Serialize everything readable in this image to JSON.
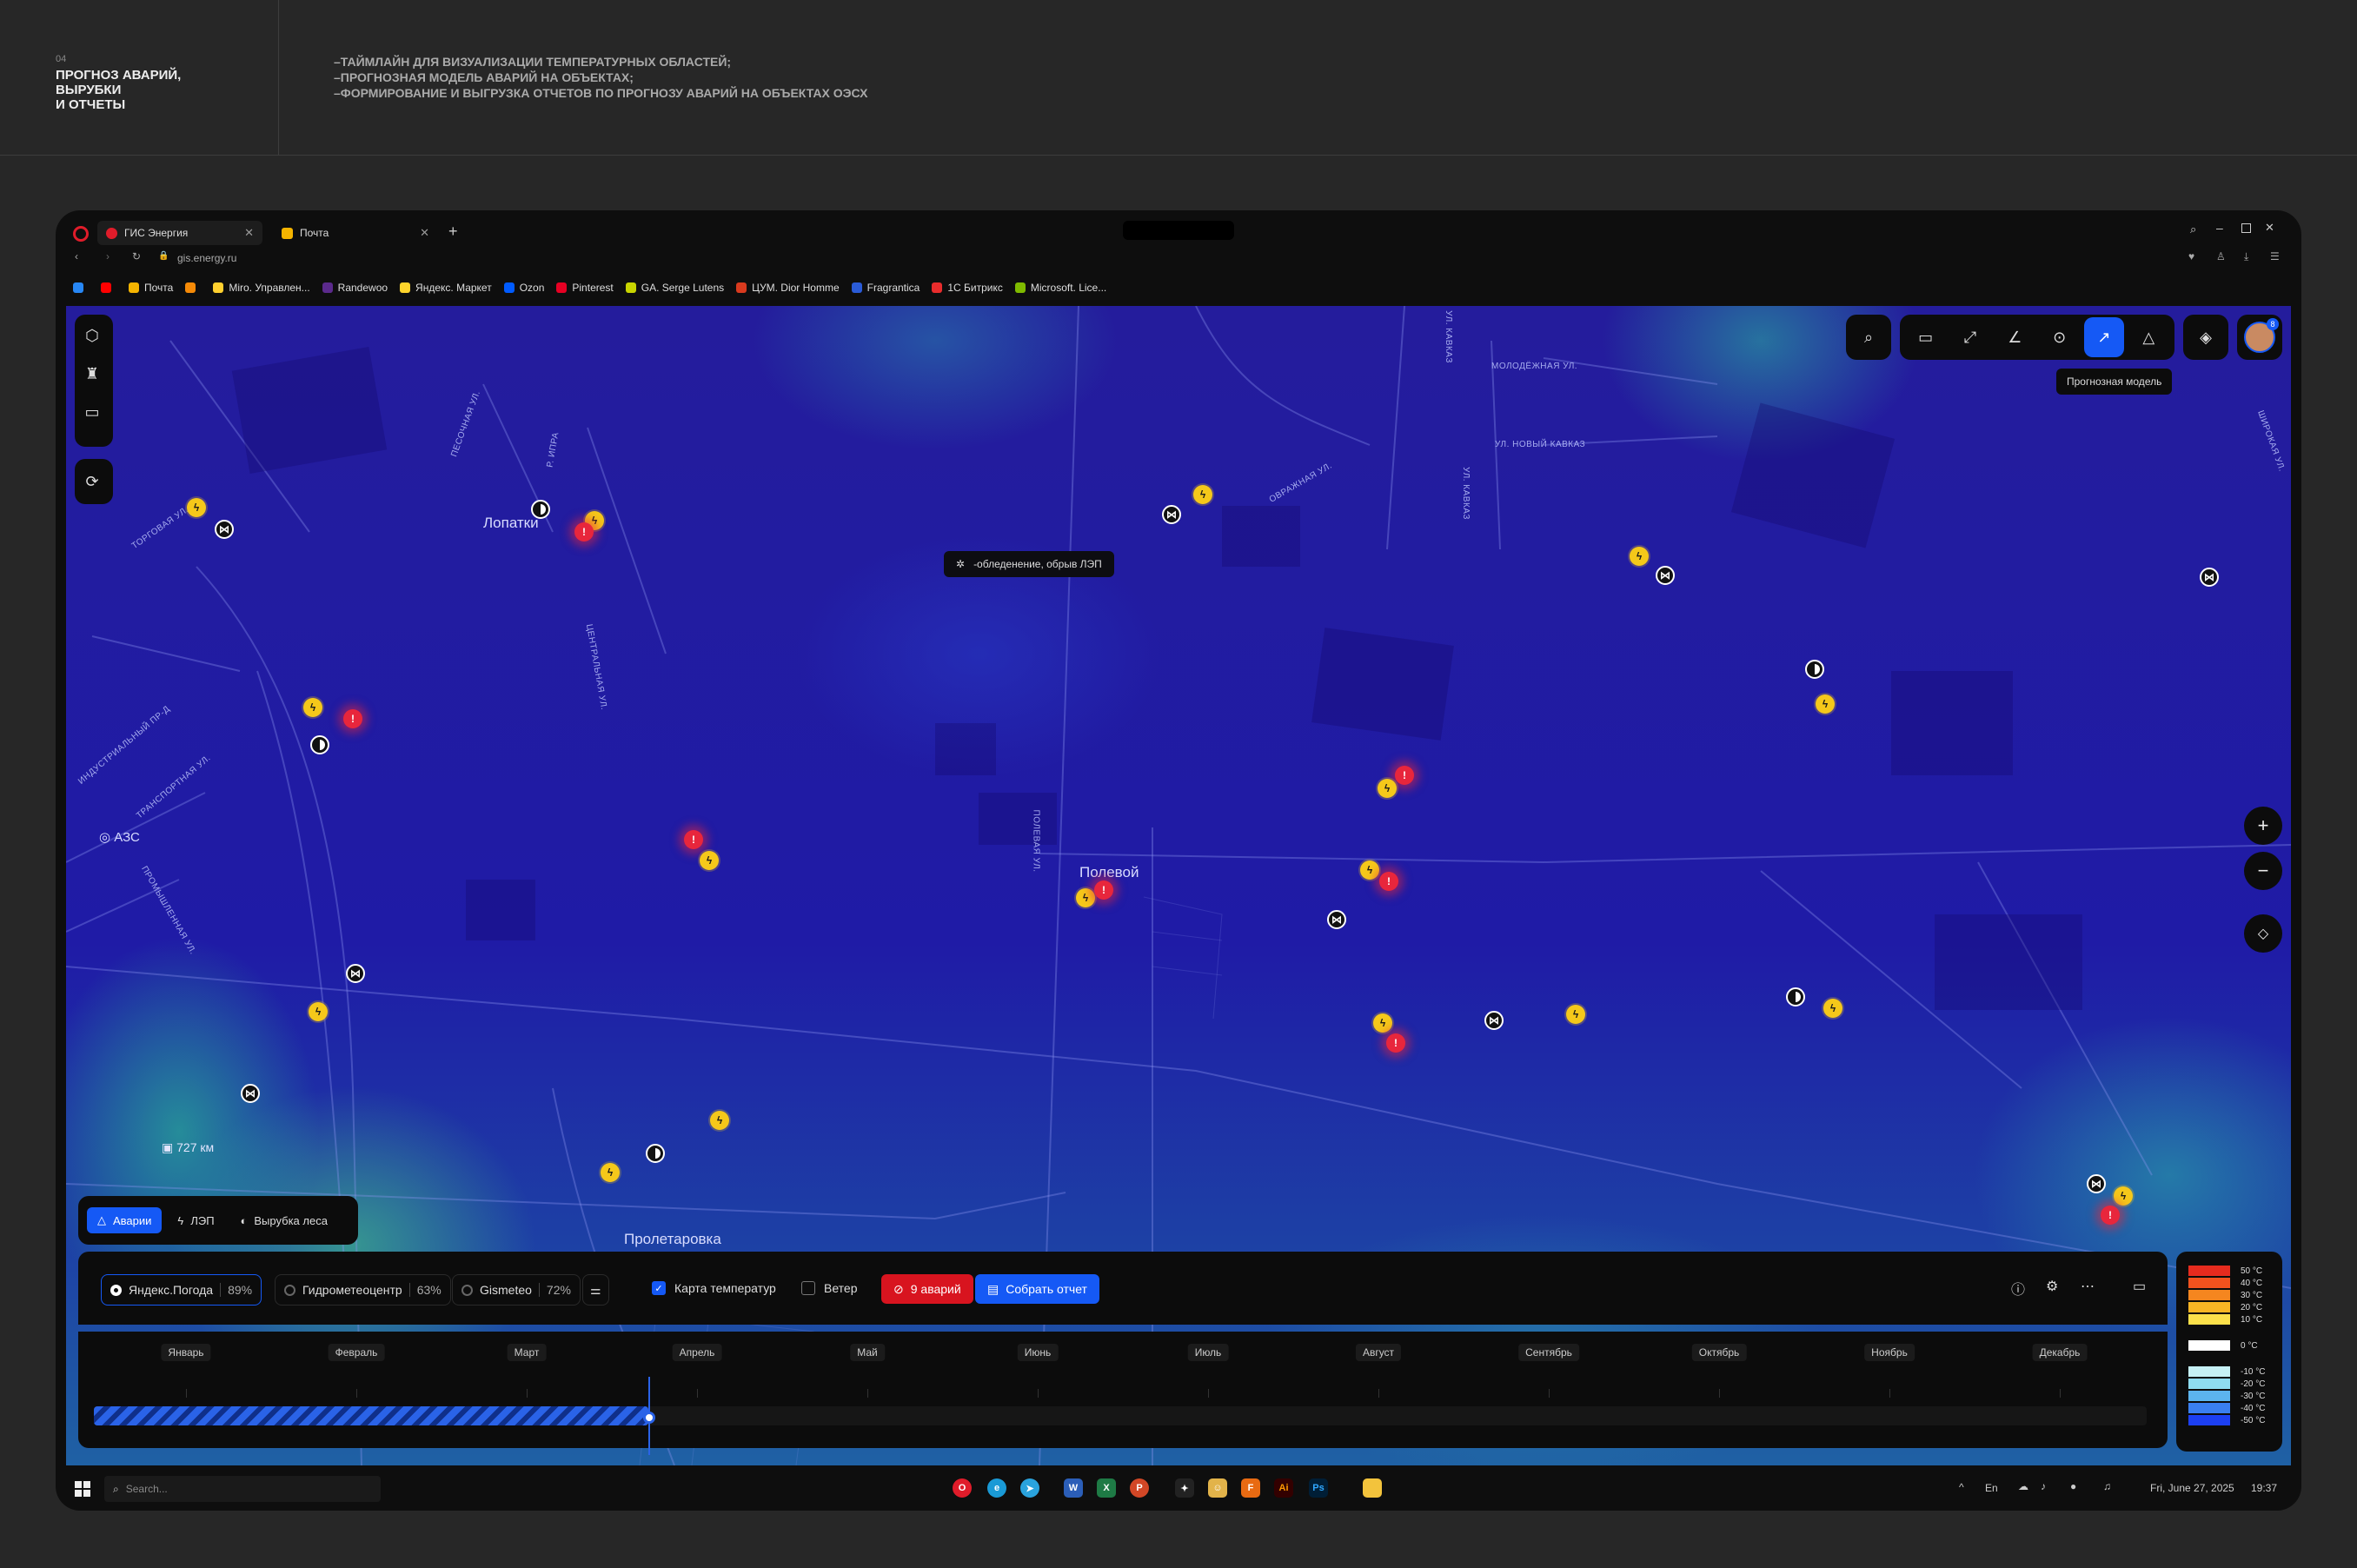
{
  "header": {
    "number": "04",
    "title": "ПРОГНОЗ АВАРИЙ, ВЫРУБКИ\nИ ОТЧЕТЫ",
    "bullets": [
      "–ТАЙМЛАЙН ДЛЯ ВИЗУАЛИЗАЦИИ ТЕМПЕРАТУРНЫХ ОБЛАСТЕЙ;",
      "–ПРОГНОЗНАЯ МОДЕЛЬ АВАРИЙ НА ОБЪЕКТАХ;",
      "–ФОРМИРОВАНИЕ И ВЫГРУЗКА ОТЧЕТОВ ПО ПРОГНОЗУ АВАРИЙ НА ОБЪЕКТАХ ОЭСХ"
    ]
  },
  "browser": {
    "tabs": [
      {
        "label": "ГИС Энергия",
        "icon": "opera-icon",
        "color": "#e01c2a"
      },
      {
        "label": "Почта",
        "icon": "mail-icon",
        "color": "#f5b400"
      }
    ],
    "url": "gis.energy.ru",
    "bookmarks": [
      {
        "label": "",
        "color": "#2787f5"
      },
      {
        "label": "",
        "color": "#ff0000"
      },
      {
        "label": "Почта",
        "color": "#f5b400"
      },
      {
        "label": "",
        "color": "#f58a07"
      },
      {
        "label": "Miro. Управлен...",
        "color": "#ffd02f"
      },
      {
        "label": "Randewoo",
        "color": "#5b2a8c"
      },
      {
        "label": "Яндекс. Маркет",
        "color": "#fed42b"
      },
      {
        "label": "Ozon",
        "color": "#005bff"
      },
      {
        "label": "Pinterest",
        "color": "#e60023"
      },
      {
        "label": "GA. Serge Lutens",
        "color": "#c8d400"
      },
      {
        "label": "ЦУМ. Dior Homme",
        "color": "#d93a1e"
      },
      {
        "label": "Fragrantica",
        "color": "#2a5bd7"
      },
      {
        "label": "1С Битрикс",
        "color": "#e82c2c"
      },
      {
        "label": "Microsoft. Lice...",
        "color": "#7fba00"
      }
    ]
  },
  "map": {
    "labels": {
      "lopatki": "Лопатки",
      "polevoy": "Полевой",
      "proletarovka": "Пролетаровка",
      "azs": "АЗС",
      "scale": "727 км"
    },
    "streets": [
      "МОЛОДЁЖНАЯ УЛ.",
      "УЛ. НОВЫЙ КАВКАЗ",
      "УЛ. КАВКАЗ",
      "УЛ. КАВКАЗ",
      "ОВРАЖНАЯ УЛ.",
      "ПОЛЕВАЯ УЛ.",
      "ЦЕНТРАЛЬНАЯ УЛ.",
      "ПРОМЫШЛЕННАЯ УЛ.",
      "ИНДУСТРИАЛЬНЫЙ ПР-Д",
      "ТРАНСПОРТНАЯ УЛ.",
      "ТОРГОВАЯ УЛ.",
      "ПЕСОЧНАЯ УЛ.",
      "ШИРОКАЯ УЛ.",
      "Р. ИПРА"
    ],
    "tooltip": "-обледенение, обрыв ЛЭП",
    "toolbar_hint": "Прогнозная модель"
  },
  "layers": [
    {
      "label": "Аварии",
      "icon": "warning-icon",
      "active": true
    },
    {
      "label": "ЛЭП",
      "icon": "bolt-icon",
      "active": false
    },
    {
      "label": "Вырубка леса",
      "icon": "forest-icon",
      "active": false
    }
  ],
  "sources": [
    {
      "label": "Яндекс.Погода",
      "percent": "89%",
      "active": true
    },
    {
      "label": "Гидрометеоцентр",
      "percent": "63%",
      "active": false
    },
    {
      "label": "Gismeteo",
      "percent": "72%",
      "active": false
    }
  ],
  "toggles": {
    "temperature_map": {
      "label": "Карта температур",
      "checked": true
    },
    "wind": {
      "label": "Ветер",
      "checked": false
    }
  },
  "actions": {
    "accidents": "9 аварий",
    "report": "Собрать отчет"
  },
  "timeline": {
    "months": [
      "Январь",
      "Февраль",
      "Март",
      "Апрель",
      "Май",
      "Июнь",
      "Июль",
      "Август",
      "Сентябрь",
      "Октябрь",
      "Ноябрь",
      "Декабрь"
    ],
    "progress": 0.27
  },
  "legend": [
    {
      "label": "50 °С",
      "color": "#e62b1e"
    },
    {
      "label": "40 °С",
      "color": "#f2521e"
    },
    {
      "label": "30 °С",
      "color": "#f5861f"
    },
    {
      "label": "20 °С",
      "color": "#f8b524"
    },
    {
      "label": "10 °С",
      "color": "#fbe04a"
    },
    {
      "label": "0 °С",
      "color": "#ffffff"
    },
    {
      "label": "-10 °С",
      "color": "#c6f1f5"
    },
    {
      "label": "-20 °С",
      "color": "#8fdcf0"
    },
    {
      "label": "-30 °С",
      "color": "#5cb4ee"
    },
    {
      "label": "-40 °С",
      "color": "#3a7ff0"
    },
    {
      "label": "-50 °С",
      "color": "#1c3ff2"
    }
  ],
  "taskbar": {
    "search": "Search...",
    "lang": "En",
    "date": "Fri, June 27, 2025",
    "time": "19:37"
  },
  "avatar_badge": "8"
}
